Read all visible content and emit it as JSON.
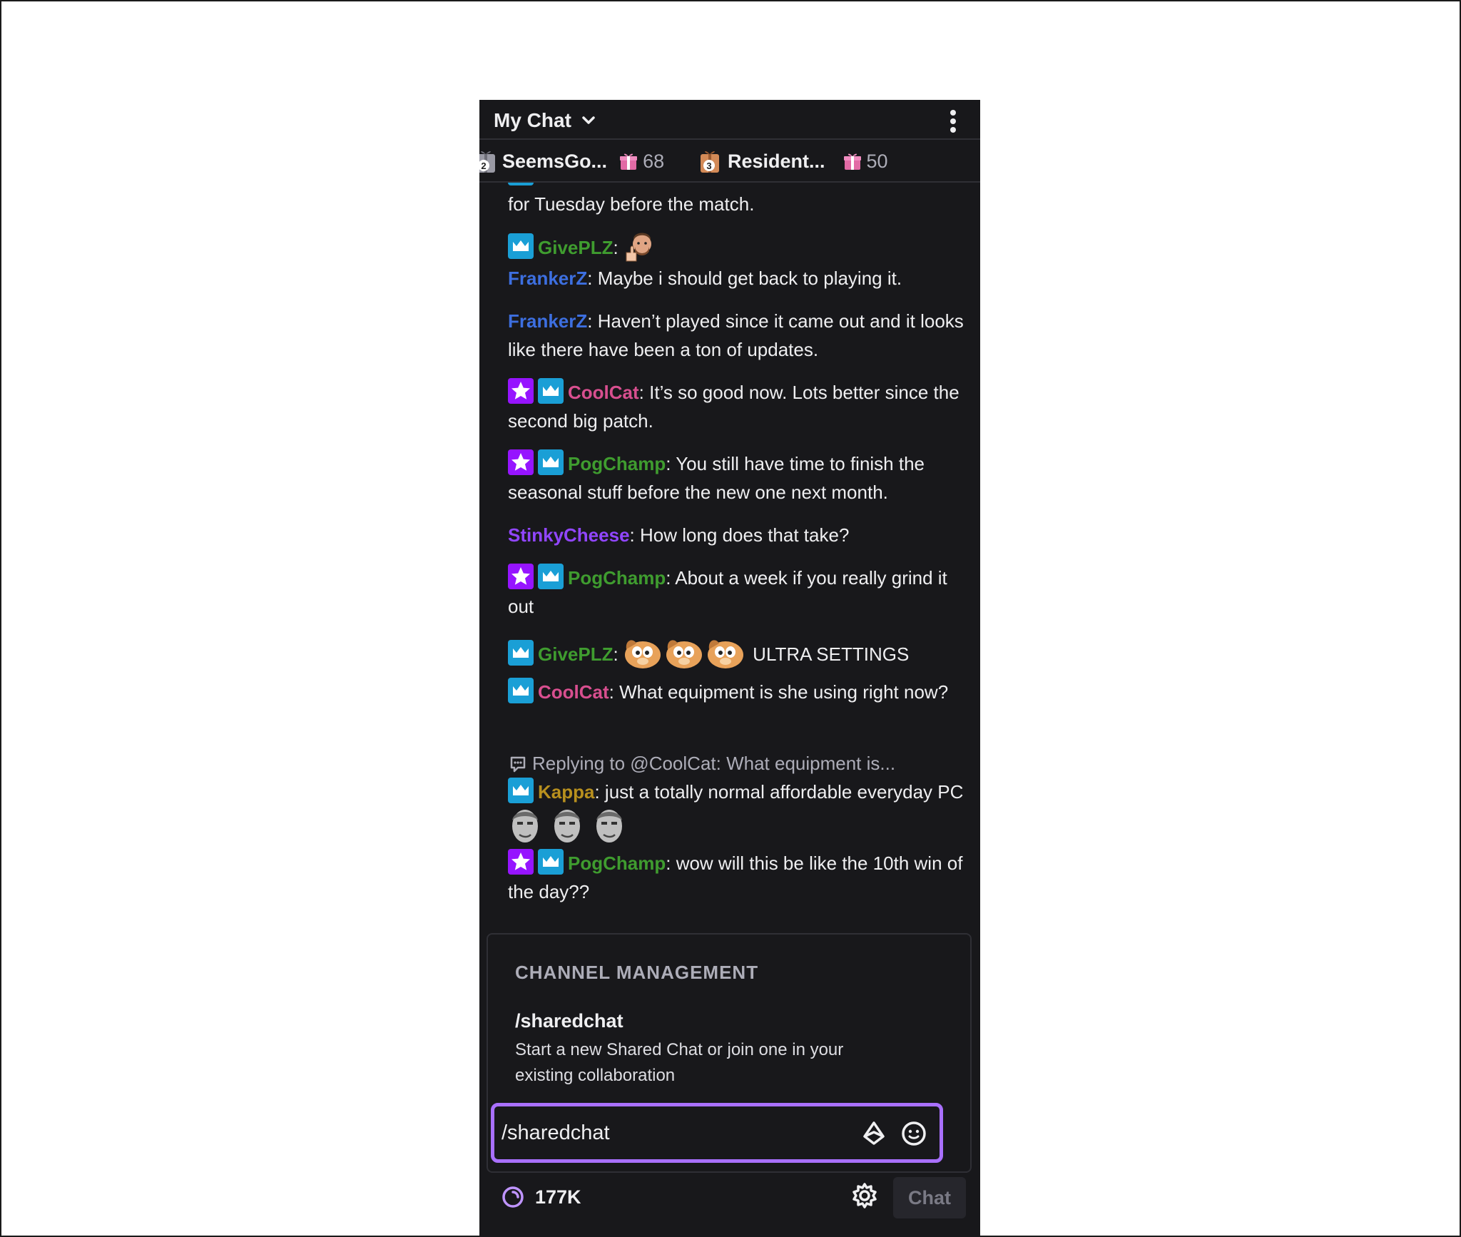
{
  "header": {
    "title": "My Chat",
    "dropdown_icon": "chevron-down-icon",
    "more_icon": "more-vertical-icon"
  },
  "leaderboard": {
    "entries": [
      {
        "rank": "2",
        "name": "SeemsGo...",
        "gifts": "68"
      },
      {
        "rank": "3",
        "name": "Resident...",
        "gifts": "50"
      }
    ]
  },
  "colors": {
    "panel_bg": "#18181b",
    "accent": "#a970ff",
    "sub_badge": "#1a9fd6",
    "star_badge": "#9614ff"
  },
  "messages": [
    {
      "user": "",
      "text": "for Tuesday before the match.",
      "color": ""
    },
    {
      "user": "GivePLZ",
      "text": "",
      "color": "#3f9c2f",
      "badges": [
        "sub"
      ],
      "emotes": [
        "thumbs-up-man-emote"
      ]
    },
    {
      "user": "FrankerZ",
      "text": "Maybe i should get back to playing it.",
      "color": "#3d6fe0"
    },
    {
      "user": "FrankerZ",
      "text": "Haven’t played since it came out and it looks like there have been a ton of updates.",
      "color": "#3d6fe0"
    },
    {
      "user": "CoolCat",
      "text": "It’s so good now. Lots better since the second big patch.",
      "color": "#d84f8f",
      "badges": [
        "star",
        "sub"
      ]
    },
    {
      "user": "PogChamp",
      "text": "You still have time to finish the seasonal stuff before the new one next month.",
      "color": "#3f9c2f",
      "badges": [
        "star",
        "sub"
      ]
    },
    {
      "user": "StinkyCheese",
      "text": "How long does that take?",
      "color": "#9146ff"
    },
    {
      "user": "PogChamp",
      "text": "About a week if you really grind it out",
      "color": "#3f9c2f",
      "badges": [
        "star",
        "sub"
      ]
    },
    {
      "user": "GivePLZ",
      "text": "ULTRA SETTINGS",
      "color": "#3f9c2f",
      "badges": [
        "sub"
      ],
      "emotes": [
        "dog-emote",
        "dog-emote",
        "dog-emote"
      ]
    },
    {
      "user": "CoolCat",
      "text": "What equipment is she using right now?",
      "color": "#d84f8f",
      "badges": [
        "sub"
      ]
    },
    {
      "reply_to": "Replying to @CoolCat: What equipment is...",
      "user": "Kappa",
      "text": "just a totally normal affordable everyday PC",
      "color": "#b8901e",
      "badges": [
        "sub"
      ],
      "emotes": [
        "kappa-emote",
        "kappa-emote",
        "kappa-emote"
      ]
    },
    {
      "user": "PogChamp",
      "text": "wow will this be like the 10th win of the day??",
      "color": "#3f9c2f",
      "badges": [
        "star",
        "sub"
      ]
    }
  ],
  "command_suggestion": {
    "section": "CHANNEL MANAGEMENT",
    "command": "/sharedchat",
    "description": "Start a new Shared Chat or join one in your existing collaboration"
  },
  "input": {
    "value": "/sharedchat",
    "bits_icon": "bits-icon",
    "emote_icon": "emote-picker-icon"
  },
  "footer": {
    "points": "177K",
    "points_icon": "channel-points-icon",
    "settings_icon": "gear-icon",
    "chat_button": "Chat"
  }
}
